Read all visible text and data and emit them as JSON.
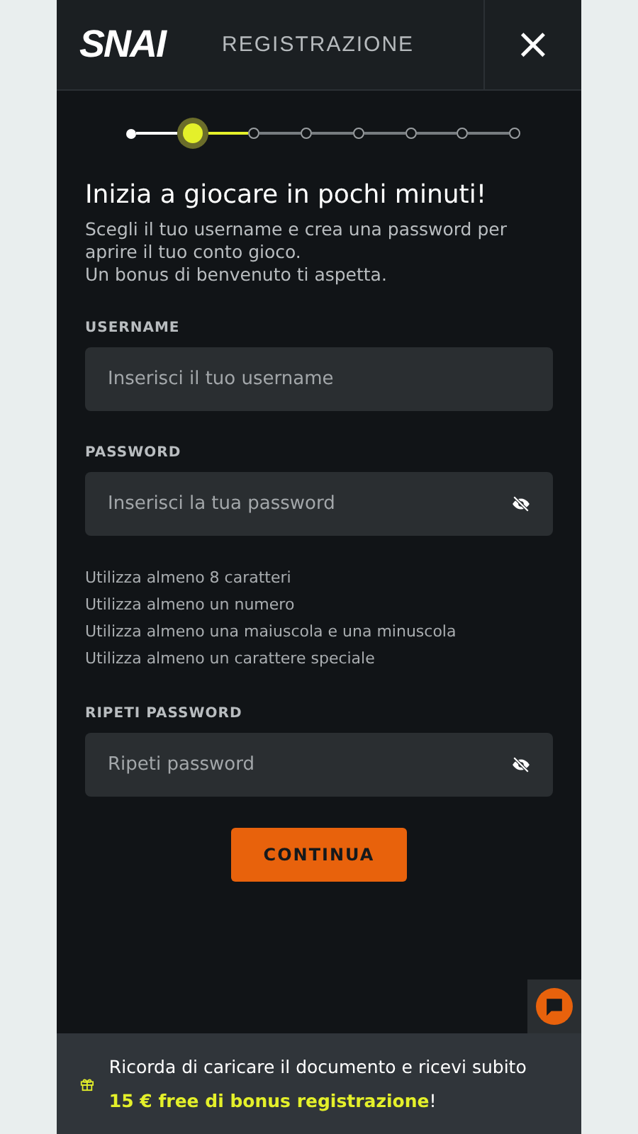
{
  "header": {
    "logo": "SNAI",
    "title": "REGISTRAZIONE",
    "close": "×"
  },
  "steps": [
    {
      "kind": "done"
    },
    {
      "kind": "current"
    },
    {
      "kind": "pending"
    },
    {
      "kind": "pending"
    },
    {
      "kind": "pending"
    },
    {
      "kind": "pending"
    },
    {
      "kind": "pending"
    },
    {
      "kind": "pending"
    }
  ],
  "intro": {
    "title": "Inizia a giocare in pochi minuti!",
    "lines": [
      "Scegli il tuo username e crea una password per aprire il tuo conto gioco.",
      "Un bonus di benvenuto ti aspetta."
    ]
  },
  "fields": [
    {
      "kind": "text",
      "label": "USERNAME",
      "placeholder": "Inserisci il tuo username"
    },
    {
      "kind": "password",
      "label": "PASSWORD",
      "placeholder": "Inserisci la tua password",
      "rules": [
        "Utilizza almeno 8 caratteri",
        "Utilizza almeno un numero",
        "Utilizza almeno una maiuscola e una minuscola",
        "Utilizza almeno un carattere speciale"
      ]
    },
    {
      "kind": "password",
      "label": "RIPETI PASSWORD",
      "placeholder": "Ripeti password"
    }
  ],
  "submit": "CONTINUA",
  "banner": {
    "text": "Ricorda di caricare il documento e ricevi subito **15 € free di bonus registrazione**!"
  }
}
